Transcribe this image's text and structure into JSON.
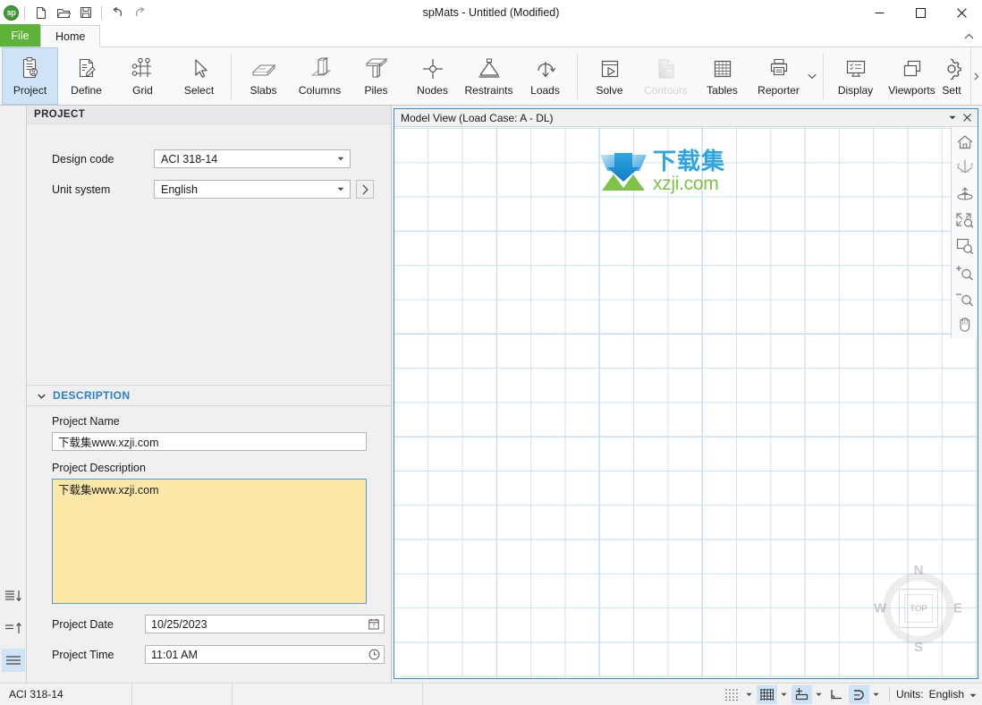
{
  "window": {
    "title": "spMats - Untitled (Modified)",
    "minimize": "—",
    "maximize": "□",
    "close": "✕"
  },
  "quick_access": {
    "logo_text": "sp",
    "buttons": [
      {
        "name": "new-file",
        "label": "New"
      },
      {
        "name": "open-file",
        "label": "Open"
      },
      {
        "name": "save-file",
        "label": "Save"
      },
      {
        "name": "undo",
        "label": "Undo"
      },
      {
        "name": "redo",
        "label": "Redo"
      }
    ]
  },
  "tabs": {
    "file": "File",
    "items": [
      {
        "label": "Home",
        "active": true
      }
    ],
    "collapse_tooltip": "Collapse the Ribbon"
  },
  "ribbon": {
    "groups": [
      {
        "buttons": [
          {
            "label": "Project",
            "icon": "clipboard-search-icon",
            "selected": true
          },
          {
            "label": "Define",
            "icon": "document-edit-icon",
            "selected": false
          },
          {
            "label": "Grid",
            "icon": "grid-nodes-icon",
            "selected": false
          },
          {
            "label": "Select",
            "icon": "cursor-arrow-icon",
            "selected": false
          }
        ]
      },
      {
        "buttons": [
          {
            "label": "Slabs",
            "icon": "slab-icon",
            "selected": false
          },
          {
            "label": "Columns",
            "icon": "column-icon",
            "selected": false
          },
          {
            "label": "Piles",
            "icon": "pile-icon",
            "selected": false
          },
          {
            "label": "Nodes",
            "icon": "node-crosshair-icon",
            "selected": false
          },
          {
            "label": "Restraints",
            "icon": "restraint-support-icon",
            "selected": false
          },
          {
            "label": "Loads",
            "icon": "load-arrow-icon",
            "selected": false
          }
        ]
      },
      {
        "buttons": [
          {
            "label": "Solve",
            "icon": "solve-play-icon",
            "selected": false
          },
          {
            "label": "Contours",
            "icon": "contours-icon",
            "selected": false,
            "disabled": true
          },
          {
            "label": "Tables",
            "icon": "table-grid-icon",
            "selected": false
          },
          {
            "label": "Reporter",
            "icon": "printer-icon",
            "selected": false,
            "has_dropdown": true
          }
        ]
      },
      {
        "buttons": [
          {
            "label": "Display",
            "icon": "monitor-display-icon",
            "selected": false
          },
          {
            "label": "Viewports",
            "icon": "viewports-windows-icon",
            "selected": false
          },
          {
            "label": "Sett",
            "icon": "gear-icon",
            "selected": false,
            "has_dropdown": true
          }
        ]
      }
    ]
  },
  "left_strip": {
    "buttons": [
      {
        "name": "sort-descending-icon",
        "label": "Sort descending",
        "active": false
      },
      {
        "name": "sort-ascending-icon",
        "label": "Sort ascending",
        "active": false
      },
      {
        "name": "list-menu-icon",
        "label": "List",
        "active": true
      }
    ]
  },
  "project_panel": {
    "header": "PROJECT",
    "design_code": {
      "label": "Design code",
      "value": "ACI 318-14"
    },
    "unit_system": {
      "label": "Unit system",
      "value": "English"
    },
    "go_button": "›",
    "description": {
      "header": "DESCRIPTION",
      "project_name": {
        "label": "Project Name",
        "value": "下载集www.xzji.com"
      },
      "project_description": {
        "label": "Project Description",
        "value": "下载集www.xzji.com"
      },
      "project_date": {
        "label": "Project Date",
        "value": "10/25/2023"
      },
      "project_time": {
        "label": "Project Time",
        "value": "11:01 AM"
      }
    }
  },
  "model_view": {
    "title": "Model View (Load Case: A - DL)",
    "dropdown": "▾",
    "close": "✕",
    "watermark": {
      "cn": "下载集",
      "en": "xzji.com",
      "cn_color": "#29a3e0",
      "en_color": "#7ac143"
    },
    "tools": [
      {
        "name": "home-view-icon",
        "label": "Home view"
      },
      {
        "name": "axes-orientation-icon",
        "label": "Axes"
      },
      {
        "name": "rotate-view-icon",
        "label": "Rotate"
      },
      {
        "name": "zoom-extents-icon",
        "label": "Zoom extents"
      },
      {
        "name": "zoom-window-icon",
        "label": "Zoom window"
      },
      {
        "name": "zoom-in-icon",
        "label": "Zoom in"
      },
      {
        "name": "zoom-out-icon",
        "label": "Zoom out"
      },
      {
        "name": "pan-hand-icon",
        "label": "Pan"
      }
    ],
    "view_cube": {
      "top": "TOP",
      "north": "N",
      "south": "S",
      "west": "W",
      "east": "E"
    }
  },
  "status_bar": {
    "design_code": "ACI 318-14",
    "cells": [
      "",
      "",
      ""
    ],
    "tools": [
      {
        "name": "snap-dots-icon",
        "label": "Snap points",
        "on": false,
        "caret": true
      },
      {
        "name": "grid-toggle-icon",
        "label": "Grid",
        "on": true,
        "caret": true
      },
      {
        "name": "node-snap-icon",
        "label": "Node snap",
        "on": true,
        "caret": true
      },
      {
        "name": "ortho-icon",
        "label": "Ortho",
        "on": false,
        "caret": false
      },
      {
        "name": "polar-snap-icon",
        "label": "Polar",
        "on": true,
        "caret": true
      }
    ],
    "units_label": "Units:",
    "units_value": "English",
    "units_caret": "▾"
  },
  "colors": {
    "accent_blue": "#2a7fd4",
    "file_tab_green": "#5cb338",
    "selection_blue": "#cfe3f7",
    "highlight_yellow": "#fbe8a8",
    "grid_minor": "#cfe0f2",
    "grid_major": "#7fa9d6"
  }
}
